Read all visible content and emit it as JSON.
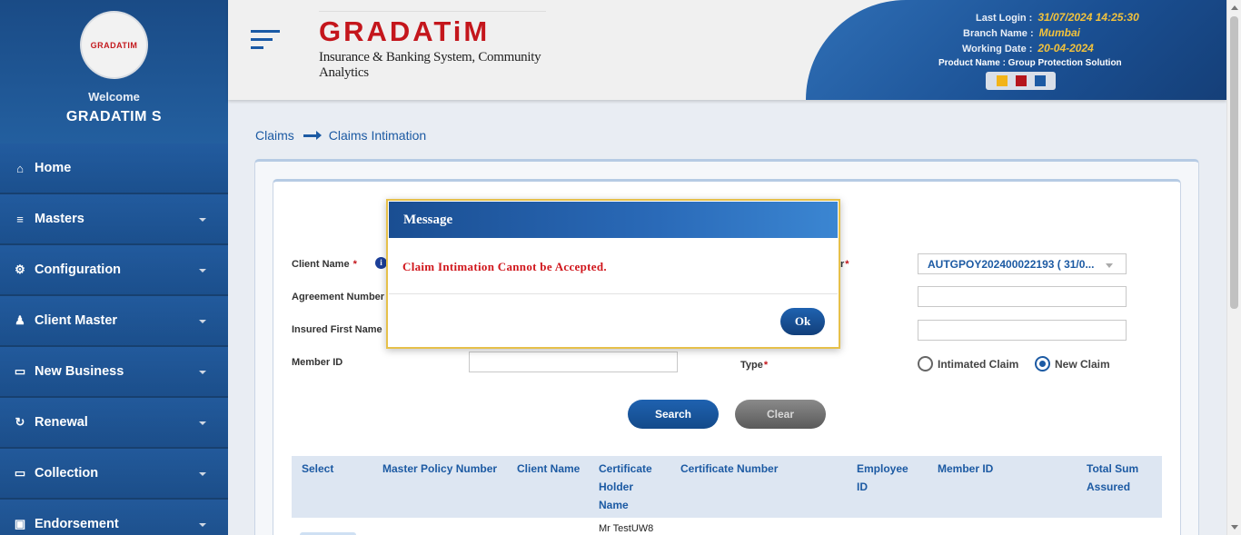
{
  "sidebar": {
    "logo_text": "GRADATIM",
    "welcome": "Welcome",
    "username": "GRADATIM S",
    "items": [
      {
        "label": "Home",
        "icon": "home-icon",
        "glyph": "⌂"
      },
      {
        "label": "Masters",
        "icon": "database-icon",
        "glyph": "≡"
      },
      {
        "label": "Configuration",
        "icon": "gears-icon",
        "glyph": "⚙"
      },
      {
        "label": "Client Master",
        "icon": "user-icon",
        "glyph": "♟"
      },
      {
        "label": "New Business",
        "icon": "monitor-icon",
        "glyph": "▭"
      },
      {
        "label": "Renewal",
        "icon": "refresh-icon",
        "glyph": "↻"
      },
      {
        "label": "Collection",
        "icon": "monitor-icon",
        "glyph": "▭"
      },
      {
        "label": "Endorsement",
        "icon": "briefcase-icon",
        "glyph": "▣"
      }
    ]
  },
  "header": {
    "brand": "GRADATiM",
    "tagline": "Insurance & Banking System, Community Analytics",
    "last_login_label": "Last Login :",
    "last_login": "31/07/2024 14:25:30",
    "branch_label": "Branch Name :",
    "branch": "Mumbai",
    "working_date_label": "Working Date :",
    "working_date": "20-04-2024",
    "product": "Product Name : Group Protection Solution",
    "theme_colors": [
      "#f2b418",
      "#b5161c",
      "#1c5aa3"
    ]
  },
  "breadcrumb": {
    "parent": "Claims",
    "current": "Claims Intimation"
  },
  "form": {
    "client_name_label": "Client Name",
    "agreement_label": "Agreement Number",
    "insured_label": "Insured First Name",
    "member_label": "Member ID",
    "policy_label": "r",
    "policy_value": "AUTGPOY202400022193 ( 31/0...",
    "type_label": "Type",
    "radio_intimated": "Intimated Claim",
    "radio_new": "New Claim",
    "req": "*"
  },
  "buttons": {
    "search": "Search",
    "clear": "Clear"
  },
  "table": {
    "headers": [
      "Select",
      "Master Policy Number",
      "Client Name",
      "Certificate\nHolder\nName",
      "Certificate Number",
      "Employee\nID",
      "Member ID",
      "Total Sum\nAssured"
    ],
    "row1_holder": "Mr TestUW8"
  },
  "modal": {
    "title": "Message",
    "message": "Claim Intimation Cannot be Accepted.",
    "ok": "Ok"
  }
}
